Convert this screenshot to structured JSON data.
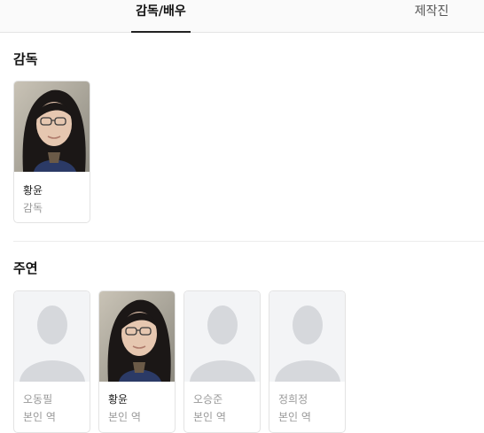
{
  "tabs": [
    {
      "label": "감독/배우",
      "active": true
    },
    {
      "label": "제작진",
      "active": false
    }
  ],
  "sections": {
    "director": {
      "title": "감독"
    },
    "cast": {
      "title": "주연"
    }
  },
  "director": [
    {
      "name": "황윤",
      "role": "감독",
      "photo": "person-photo"
    }
  ],
  "cast": [
    {
      "name": "오동필",
      "role": "본인 역",
      "photo": "silhouette-placeholder"
    },
    {
      "name": "황윤",
      "role": "본인 역",
      "photo": "person-photo"
    },
    {
      "name": "오승준",
      "role": "본인 역",
      "photo": "silhouette-placeholder"
    },
    {
      "name": "정희정",
      "role": "본인 역",
      "photo": "silhouette-placeholder"
    }
  ],
  "colors": {
    "placeholder_bg": "#f3f4f6",
    "silhouette": "#d6d8dc",
    "active_tab_underline": "#222222"
  }
}
